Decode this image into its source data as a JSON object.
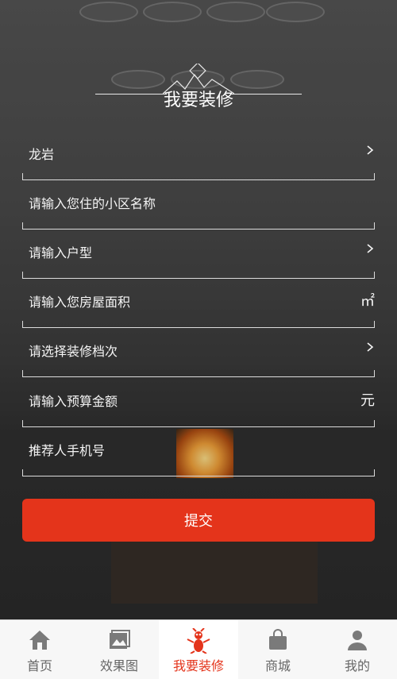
{
  "header": {
    "title": "我要装修"
  },
  "form": {
    "fields": [
      {
        "label": "龙岩",
        "suffix": "",
        "chevron": true
      },
      {
        "label": "请输入您住的小区名称",
        "suffix": "",
        "chevron": false
      },
      {
        "label": "请输入户型",
        "suffix": "",
        "chevron": true
      },
      {
        "label": "请输入您房屋面积",
        "suffix": "㎡",
        "chevron": false
      },
      {
        "label": "请选择装修档次",
        "suffix": "",
        "chevron": true
      },
      {
        "label": "请输入预算金额",
        "suffix": "元",
        "chevron": false
      },
      {
        "label": "推荐人手机号",
        "suffix": "",
        "chevron": false
      }
    ],
    "submit_label": "提交"
  },
  "tabbar": {
    "items": [
      {
        "label": "首页",
        "icon": "home-icon",
        "active": false
      },
      {
        "label": "效果图",
        "icon": "gallery-icon",
        "active": false
      },
      {
        "label": "我要装修",
        "icon": "renovate-mascot-icon",
        "active": true
      },
      {
        "label": "商城",
        "icon": "shopping-bag-icon",
        "active": false
      },
      {
        "label": "我的",
        "icon": "user-icon",
        "active": false
      }
    ]
  },
  "colors": {
    "accent": "#e4341b",
    "tab_inactive": "#666666",
    "text_on_dark": "#f4f4f4"
  }
}
